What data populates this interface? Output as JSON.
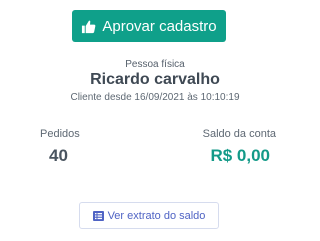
{
  "approve_button": {
    "label": "Aprovar cadastro",
    "icon": "thumbs-up-icon"
  },
  "client": {
    "person_type": "Pessoa física",
    "name": "Ricardo carvalho",
    "since": "Cliente desde 16/09/2021 às 10:10:19"
  },
  "stats": {
    "orders_label": "Pedidos",
    "orders_value": "40",
    "balance_label": "Saldo da conta",
    "balance_value": "R$ 0,00"
  },
  "statement_button": {
    "label": "Ver extrato do saldo",
    "icon": "list-icon"
  },
  "colors": {
    "primary": "#0fa08a",
    "balance": "#139a88",
    "link": "#4f63c4"
  }
}
